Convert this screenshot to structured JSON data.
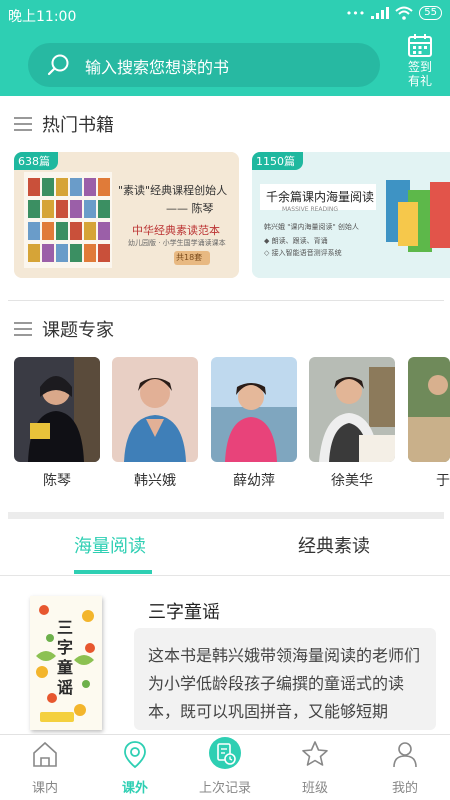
{
  "status": {
    "time": "晚上11:00",
    "battery": "55"
  },
  "search": {
    "placeholder": "输入搜索您想读的书"
  },
  "signin": {
    "line1": "签到",
    "line2": "有礼"
  },
  "hot_books": {
    "title": "热门书籍",
    "cards": [
      {
        "count": "638篇",
        "heading": "\"素读\"经典课程创始人",
        "author": "—— 陈琴",
        "subtitle": "中华经典素读范本",
        "small": "幼儿园版 · 小学生国学诵读课本",
        "tag": "共18套"
      },
      {
        "count": "1150篇",
        "heading": "千余篇课内海量阅读",
        "en": "MASSIVE READING",
        "founder": "韩兴娥 \"课内海量阅读\" 创始人",
        "bullet1": "◆ 朗读、跟读、背诵",
        "bullet2": "◇ 接入智能语音测评系统"
      }
    ]
  },
  "experts": {
    "title": "课题专家",
    "items": [
      {
        "name": "陈琴"
      },
      {
        "name": "韩兴娥"
      },
      {
        "name": "薛幼萍"
      },
      {
        "name": "徐美华"
      },
      {
        "name": "于"
      }
    ]
  },
  "tabs": {
    "active": "海量阅读",
    "inactive": "经典素读"
  },
  "featured": {
    "title": "三字童谣",
    "cover_text": "三字童谣",
    "desc": "这本书是韩兴娥带领海量阅读的老师们为小学低龄段孩子编撰的童谣式的读本，既可以巩固拼音，又能够短期"
  },
  "nav": [
    {
      "label": "课内"
    },
    {
      "label": "课外"
    },
    {
      "label": "上次记录"
    },
    {
      "label": "班级"
    },
    {
      "label": "我的"
    }
  ],
  "colors": {
    "accent": "#2ecfb3",
    "accent_dark": "#27b9a2"
  }
}
